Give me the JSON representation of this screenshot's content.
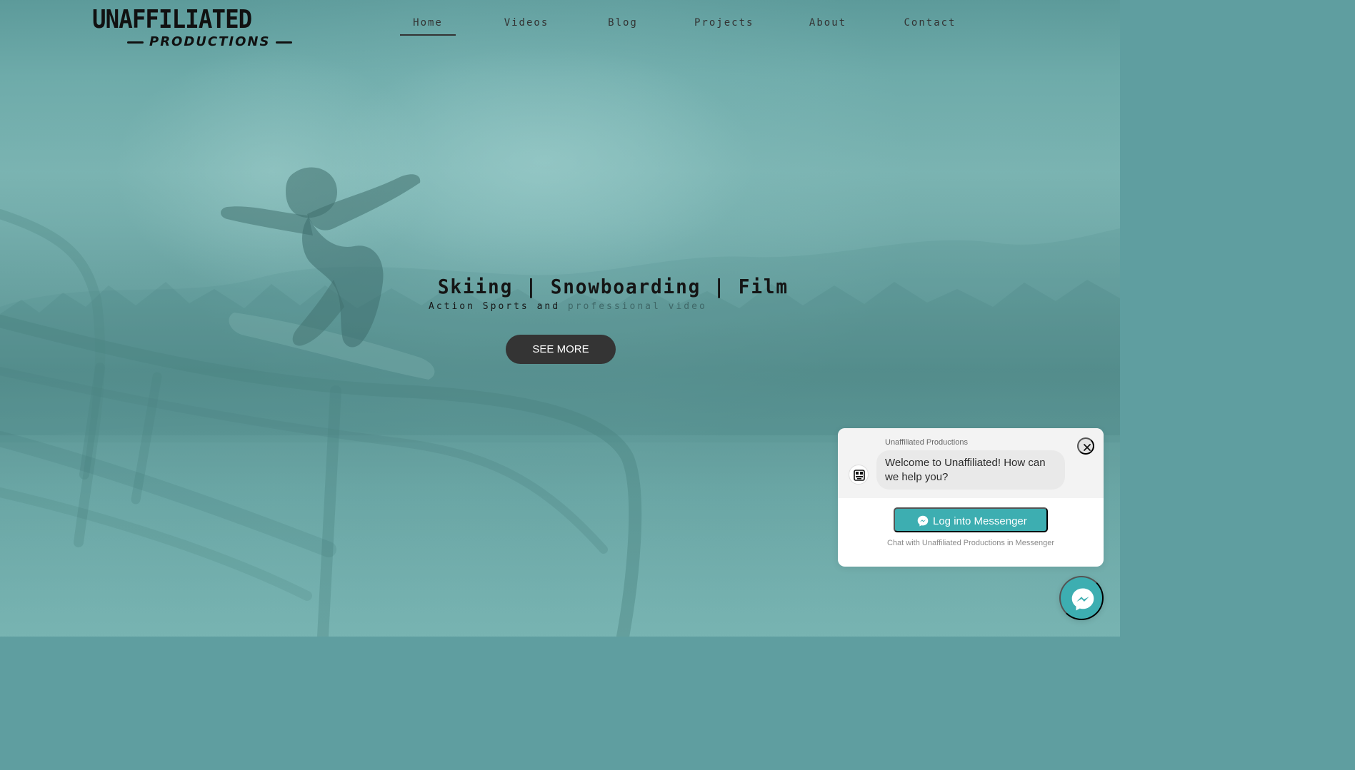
{
  "brand": {
    "logo_top": "UNAFFILIATED",
    "logo_bottom": "PRODUCTIONS"
  },
  "nav": {
    "items": [
      {
        "label": "Home",
        "active": true
      },
      {
        "label": "Videos",
        "active": false
      },
      {
        "label": "Blog",
        "active": false
      },
      {
        "label": "Projects",
        "active": false
      },
      {
        "label": "About",
        "active": false
      },
      {
        "label": "Contact",
        "active": false
      }
    ]
  },
  "hero": {
    "title": "Skiing | Snowboarding | Film",
    "subtitle_primary": "Action Sports and",
    "subtitle_secondary": "professional video",
    "cta_label": "SEE MORE"
  },
  "chat_widget": {
    "page_name": "Unaffiliated Productions",
    "welcome_message": "Welcome to Unaffiliated! How can we help you?",
    "login_label": "Log into Messenger",
    "footer_note": "Chat with Unaffiliated Productions in Messenger"
  },
  "icons": {
    "close": "close-icon",
    "messenger": "messenger-icon",
    "avatar": "page-avatar-icon"
  },
  "colors": {
    "teal_overlay": "#5f9ea0",
    "button_dark": "#343434",
    "messenger_accent": "#3daeb1",
    "chat_bubble": "#e9e9e9"
  }
}
